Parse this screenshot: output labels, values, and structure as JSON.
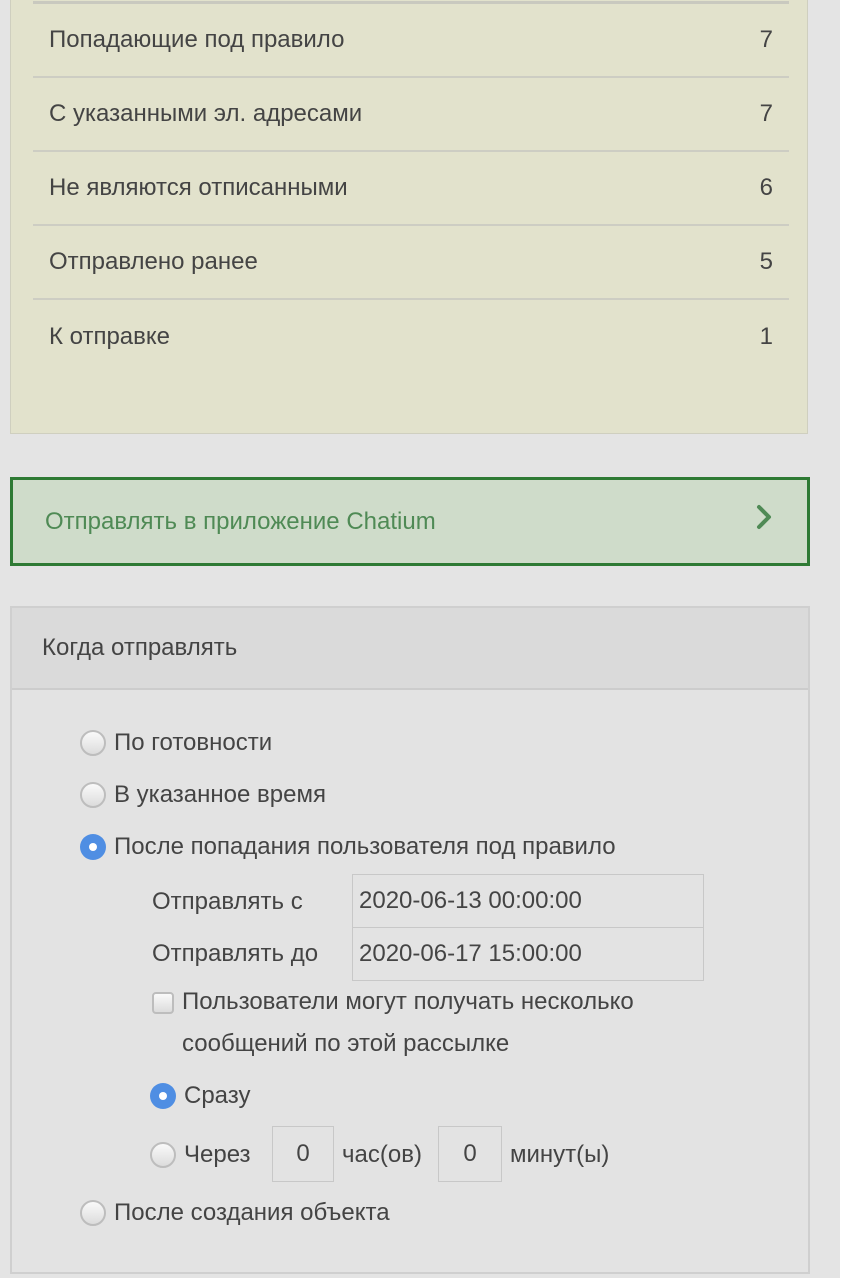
{
  "stats": {
    "rows": [
      {
        "label": "Попадающие под правило",
        "value": "7"
      },
      {
        "label": "С указанными эл. адресами",
        "value": "7"
      },
      {
        "label": "Не являются отписанными",
        "value": "6"
      },
      {
        "label": "Отправлено ранее",
        "value": "5"
      },
      {
        "label": "К отправке",
        "value": "1"
      }
    ]
  },
  "chatium": {
    "label": "Отправлять в приложение Chatium",
    "icon": "chevron-right-icon",
    "color": "#2e7a34"
  },
  "when": {
    "title": "Когда отправлять",
    "options": {
      "ready": "По готовности",
      "specified_time": "В указанное время",
      "after_rule": "После попадания пользователя под правило",
      "after_create": "После создания объекта"
    },
    "selected": "after_rule",
    "send_from_label": "Отправлять с",
    "send_from_value": "2020-06-13 00:00:00",
    "send_to_label": "Отправлять до",
    "send_to_value": "2020-06-17 15:00:00",
    "multiple_label_line1": "Пользователи могут получать несколько",
    "multiple_label_line2": "сообщений по этой рассылке",
    "multiple_checked": false,
    "timing": {
      "immediately": "Сразу",
      "after": "Через",
      "hours_value": "0",
      "hours_label": "час(ов)",
      "minutes_value": "0",
      "minutes_label": "минут(ы)",
      "selected": "immediately"
    },
    "radio_color": "#4f8ee3"
  }
}
